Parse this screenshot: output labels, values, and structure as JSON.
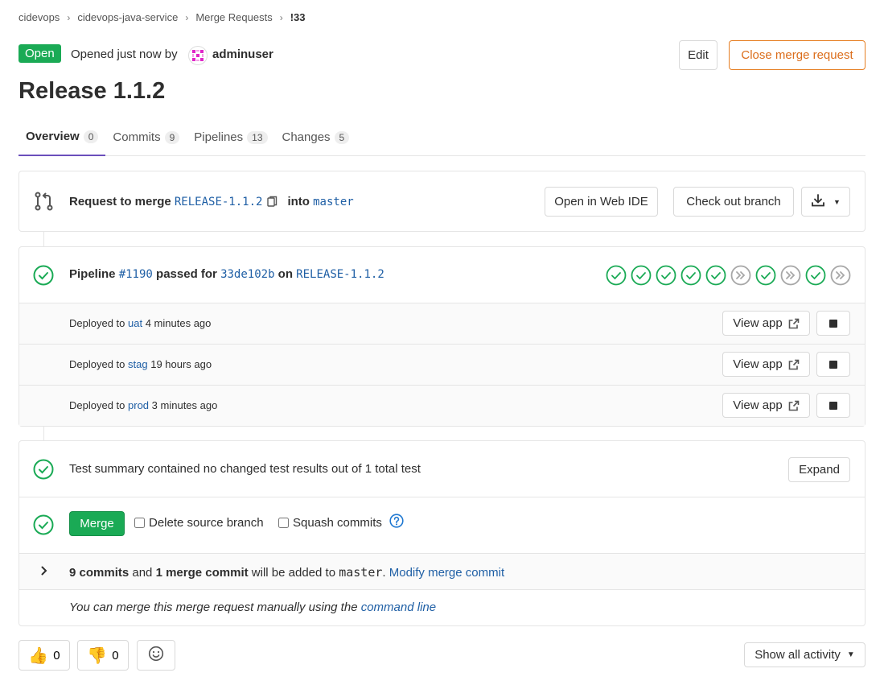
{
  "breadcrumb": [
    "cidevops",
    "cidevops-java-service",
    "Merge Requests",
    "!33"
  ],
  "header": {
    "status": "Open",
    "opened_text": "Opened just now by",
    "author": "adminuser",
    "edit_label": "Edit",
    "close_label": "Close merge request"
  },
  "title": "Release 1.1.2",
  "tabs": [
    {
      "label": "Overview",
      "count": "0"
    },
    {
      "label": "Commits",
      "count": "9"
    },
    {
      "label": "Pipelines",
      "count": "13"
    },
    {
      "label": "Changes",
      "count": "5"
    }
  ],
  "merge_request": {
    "prefix": "Request to merge",
    "source_branch": "RELEASE-1.1.2",
    "into": "into",
    "target_branch": "master",
    "webide_label": "Open in Web IDE",
    "checkout_label": "Check out branch"
  },
  "pipeline": {
    "label": "Pipeline",
    "id": "#1190",
    "passed_for": "passed for",
    "commit": "33de102b",
    "on": "on",
    "branch": "RELEASE-1.1.2",
    "stages": [
      "passed",
      "passed",
      "passed",
      "passed",
      "passed",
      "skipped",
      "passed",
      "skipped",
      "passed",
      "skipped"
    ]
  },
  "deployments": [
    {
      "prefix": "Deployed to",
      "env": "uat",
      "time": "4 minutes ago",
      "view_label": "View app"
    },
    {
      "prefix": "Deployed to",
      "env": "stag",
      "time": "19 hours ago",
      "view_label": "View app"
    },
    {
      "prefix": "Deployed to",
      "env": "prod",
      "time": "3 minutes ago",
      "view_label": "View app"
    }
  ],
  "test_summary": {
    "text": "Test summary contained no changed test results out of 1 total test",
    "expand_label": "Expand"
  },
  "merge": {
    "merge_label": "Merge",
    "delete_source_label": "Delete source branch",
    "squash_label": "Squash commits"
  },
  "commits_info": {
    "commits": "9 commits",
    "and": "and",
    "merge_commit": "1 merge commit",
    "will_be_added": "will be added to",
    "target": "master",
    "period": ".",
    "modify_label": "Modify merge commit"
  },
  "manual": {
    "text": "You can merge this merge request manually using the",
    "link": "command line"
  },
  "awards": {
    "thumbsup_count": "0",
    "thumbsdown_count": "0"
  },
  "activity_label": "Show all activity",
  "colors": {
    "success": "#1aaa55",
    "link": "#1f5fa5",
    "warning": "#db6d1b",
    "active_tab": "#6b4fbb"
  }
}
